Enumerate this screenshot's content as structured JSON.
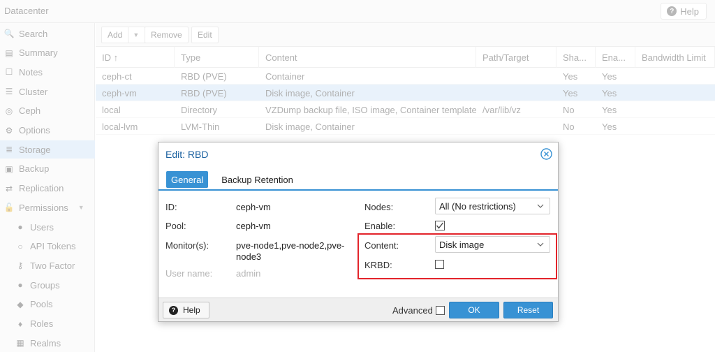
{
  "header": {
    "title": "Datacenter",
    "help_label": "Help",
    "help_icon": "question-circle-icon"
  },
  "sidebar": {
    "items": [
      {
        "label": "Search",
        "icon": "search-icon",
        "glyph": "🔍"
      },
      {
        "label": "Summary",
        "icon": "book-icon",
        "glyph": "▤"
      },
      {
        "label": "Notes",
        "icon": "notes-icon",
        "glyph": "☐"
      },
      {
        "label": "Cluster",
        "icon": "server-icon",
        "glyph": "☰"
      },
      {
        "label": "Ceph",
        "icon": "ceph-icon",
        "glyph": "◎"
      },
      {
        "label": "Options",
        "icon": "gear-icon",
        "glyph": "⚙"
      },
      {
        "label": "Storage",
        "icon": "database-icon",
        "glyph": "≣"
      },
      {
        "label": "Backup",
        "icon": "floppy-icon",
        "glyph": "▣"
      },
      {
        "label": "Replication",
        "icon": "retweet-icon",
        "glyph": "⇄"
      },
      {
        "label": "Permissions",
        "icon": "unlock-icon",
        "glyph": "🔓"
      },
      {
        "label": "Users",
        "icon": "user-icon",
        "glyph": "●"
      },
      {
        "label": "API Tokens",
        "icon": "user-outline-icon",
        "glyph": "○"
      },
      {
        "label": "Two Factor",
        "icon": "key-icon",
        "glyph": "⚷"
      },
      {
        "label": "Groups",
        "icon": "users-icon",
        "glyph": "●"
      },
      {
        "label": "Pools",
        "icon": "tags-icon",
        "glyph": "◆"
      },
      {
        "label": "Roles",
        "icon": "male-icon",
        "glyph": "♦"
      },
      {
        "label": "Realms",
        "icon": "address-book-icon",
        "glyph": "▦"
      }
    ],
    "selected": "Storage"
  },
  "toolbar": {
    "add_label": "Add",
    "remove_label": "Remove",
    "edit_label": "Edit"
  },
  "grid": {
    "columns": [
      "ID ↑",
      "Type",
      "Content",
      "Path/Target",
      "Sha...",
      "Ena...",
      "Bandwidth Limit"
    ],
    "rows": [
      {
        "id": "ceph-ct",
        "type": "RBD (PVE)",
        "content": "Container",
        "path": "",
        "shared": "Yes",
        "enabled": "Yes",
        "bw": ""
      },
      {
        "id": "ceph-vm",
        "type": "RBD (PVE)",
        "content": "Disk image, Container",
        "path": "",
        "shared": "Yes",
        "enabled": "Yes",
        "bw": ""
      },
      {
        "id": "local",
        "type": "Directory",
        "content": "VZDump backup file, ISO image, Container template",
        "path": "/var/lib/vz",
        "shared": "No",
        "enabled": "Yes",
        "bw": ""
      },
      {
        "id": "local-lvm",
        "type": "LVM-Thin",
        "content": "Disk image, Container",
        "path": "",
        "shared": "No",
        "enabled": "Yes",
        "bw": ""
      }
    ],
    "selected_row": 1
  },
  "dialog": {
    "title": "Edit: RBD",
    "tabs": [
      {
        "label": "General",
        "active": true
      },
      {
        "label": "Backup Retention",
        "active": false
      }
    ],
    "left": {
      "id_label": "ID:",
      "id_value": "ceph-vm",
      "pool_label": "Pool:",
      "pool_value": "ceph-vm",
      "monitor_label": "Monitor(s):",
      "monitor_value": "pve-node1,pve-node2,pve-node3",
      "user_label": "User name:",
      "user_value": "admin"
    },
    "right": {
      "nodes_label": "Nodes:",
      "nodes_value": "All (No restrictions)",
      "enable_label": "Enable:",
      "enable_checked": true,
      "content_label": "Content:",
      "content_value": "Disk image",
      "krbd_label": "KRBD:",
      "krbd_checked": false
    },
    "footer": {
      "help_label": "Help",
      "advanced_label": "Advanced",
      "ok_label": "OK",
      "reset_label": "Reset"
    },
    "highlight_color": "#e3242b",
    "accent_color": "#3892d4"
  }
}
